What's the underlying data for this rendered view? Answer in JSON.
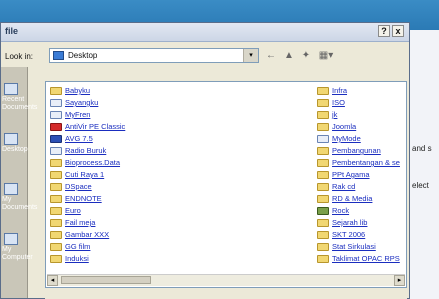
{
  "dialog": {
    "title": "file",
    "help_button": "?",
    "close_button": "x"
  },
  "lookin": {
    "label": "Look in:",
    "value": "Desktop",
    "dropdown_arrow": "▾"
  },
  "toolbar_icons": [
    "back-arrow-icon",
    "up-folder-icon",
    "new-folder-icon",
    "view-menu-icon"
  ],
  "places": [
    {
      "label": "Recent\nDocuments",
      "icon": "recent-documents-icon"
    },
    {
      "label": "Desktop",
      "icon": "desktop-icon"
    },
    {
      "label": "My\nDocuments",
      "icon": "my-documents-icon"
    },
    {
      "label": "My\nComputer",
      "icon": "my-computer-icon"
    }
  ],
  "files_left": [
    {
      "name": "Babyku",
      "icon": "folder"
    },
    {
      "name": "Sayangku",
      "icon": "doc"
    },
    {
      "name": "MyFren",
      "icon": "doc"
    },
    {
      "name": "AntiVir PE Classic",
      "icon": "red"
    },
    {
      "name": "AVG 7.5",
      "icon": "red2"
    },
    {
      "name": "Radio Buruk",
      "icon": "doc"
    },
    {
      "name": "Bioprocess.Data",
      "icon": "folder"
    },
    {
      "name": "Cuti Raya 1",
      "icon": "folder"
    },
    {
      "name": "DSpace",
      "icon": "folder"
    },
    {
      "name": "ENDNOTE",
      "icon": "folder"
    },
    {
      "name": "Euro",
      "icon": "folder"
    },
    {
      "name": "Fail meja",
      "icon": "folder"
    },
    {
      "name": "Gambar XXX",
      "icon": "folder"
    },
    {
      "name": "GG film",
      "icon": "folder"
    },
    {
      "name": "Induksi",
      "icon": "folder"
    }
  ],
  "files_right": [
    {
      "name": "Infra",
      "icon": "folder"
    },
    {
      "name": "ISO",
      "icon": "folder"
    },
    {
      "name": "jk",
      "icon": "folder"
    },
    {
      "name": "Joomla",
      "icon": "folder"
    },
    {
      "name": "MyMode",
      "icon": "doc"
    },
    {
      "name": "Pembangunan",
      "icon": "folder"
    },
    {
      "name": "Pembentangan & se",
      "icon": "folder"
    },
    {
      "name": "PPt Agama",
      "icon": "folder"
    },
    {
      "name": "Rak cd",
      "icon": "folder"
    },
    {
      "name": "RD & Media",
      "icon": "folder"
    },
    {
      "name": "Rock",
      "icon": "gear"
    },
    {
      "name": "Sejarah lib",
      "icon": "folder"
    },
    {
      "name": "SKT 2006",
      "icon": "folder"
    },
    {
      "name": "Stat Sirkulasi",
      "icon": "folder"
    },
    {
      "name": "Taklimat OPAC RPS",
      "icon": "folder"
    }
  ],
  "background_fragments": [
    "and s",
    "elect"
  ],
  "scroll": {
    "left_arrow": "◂",
    "right_arrow": "▸"
  }
}
